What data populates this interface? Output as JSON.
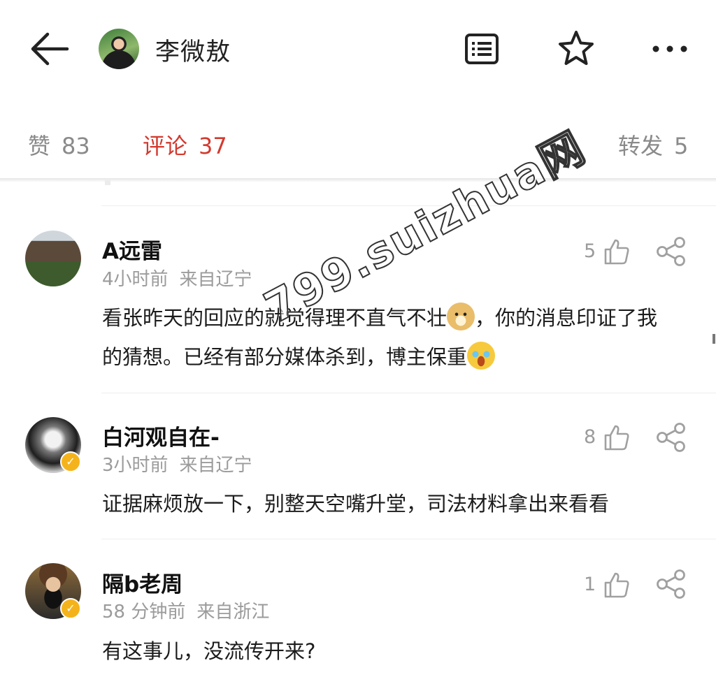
{
  "header": {
    "title": "李微敖",
    "back_icon": "arrow-left-icon",
    "list_icon": "list-icon",
    "star_icon": "star-icon",
    "more_icon": "more-dots-icon"
  },
  "tabs": [
    {
      "label": "赞",
      "count": "83",
      "active": false
    },
    {
      "label": "评论",
      "count": "37",
      "active": true
    },
    {
      "label": "转发",
      "count": "5",
      "active": false
    }
  ],
  "comments": [
    {
      "name": "A远雷",
      "time": "4小时前",
      "source": "来自辽宁",
      "text_line1_a": "看张昨天的回应的就觉得理不直气不壮",
      "text_line1_b": "，你的消息印证了我",
      "text_line2": "的猜想。已经有部分媒体杀到，博主保重",
      "likes": "5",
      "verified": false
    },
    {
      "name": "白河观自在-",
      "time": "3小时前",
      "source": "来自辽宁",
      "text": "证据麻烦放一下，别整天空嘴升堂，司法材料拿出来看看",
      "likes": "8",
      "verified": true
    },
    {
      "name": "隔b老周",
      "time": "58 分钟前",
      "source": "来自浙江",
      "text": "有这事儿，没流传开来?",
      "likes": "1",
      "verified": true
    }
  ],
  "watermark": "799.suizhua网",
  "colors": {
    "active_tab": "#d23a2f",
    "muted": "#9b9b9b",
    "badge": "#f5b31b"
  }
}
